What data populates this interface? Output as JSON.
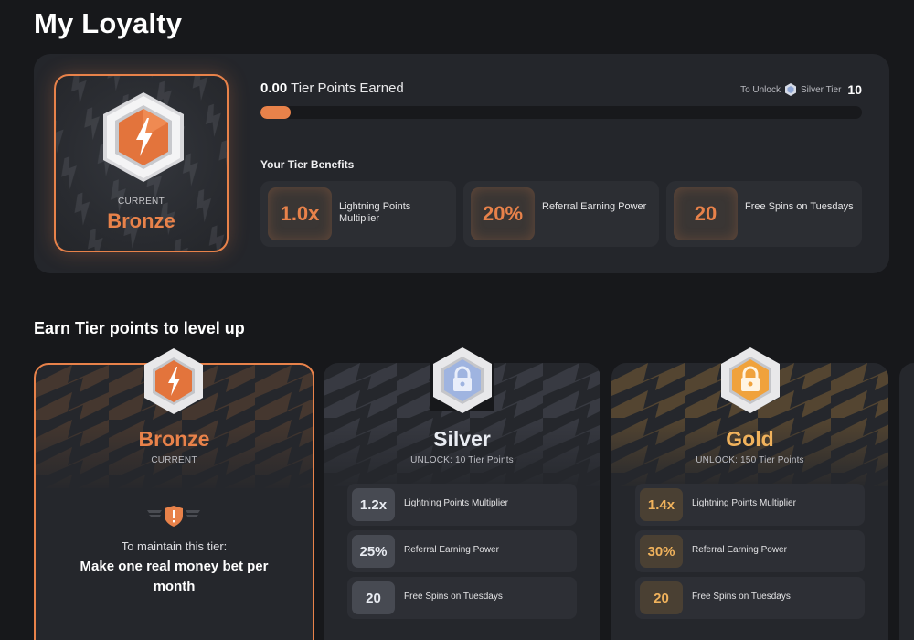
{
  "page": {
    "title": "My Loyalty"
  },
  "current_tier": {
    "label": "CURRENT",
    "name": "Bronze",
    "points_value": "0.00",
    "points_label": "Tier Points Earned",
    "unlock_prefix": "To Unlock",
    "next_tier": "Silver Tier",
    "next_tier_points": "10",
    "progress_fraction": 0.05,
    "benefits_title": "Your Tier Benefits",
    "benefits": [
      {
        "value": "1.0x",
        "label": "Lightning Points Multiplier"
      },
      {
        "value": "20%",
        "label": "Referral Earning Power"
      },
      {
        "value": "20",
        "label": "Free Spins on Tuesdays"
      }
    ]
  },
  "levels": {
    "title": "Earn Tier points to level up",
    "bronze": {
      "name": "Bronze",
      "sub": "CURRENT",
      "maintain_line1": "To maintain this tier:",
      "maintain_line2": "Make one real money bet per month"
    },
    "silver": {
      "name": "Silver",
      "sub": "UNLOCK: 10 Tier Points",
      "benefits": [
        {
          "value": "1.2x",
          "label": "Lightning Points Multiplier"
        },
        {
          "value": "25%",
          "label": "Referral Earning Power"
        },
        {
          "value": "20",
          "label": "Free Spins on Tuesdays"
        }
      ]
    },
    "gold": {
      "name": "Gold",
      "sub": "UNLOCK: 150 Tier Points",
      "benefits": [
        {
          "value": "1.4x",
          "label": "Lightning Points Multiplier"
        },
        {
          "value": "30%",
          "label": "Referral Earning Power"
        },
        {
          "value": "20",
          "label": "Free Spins on Tuesdays"
        }
      ]
    }
  },
  "colors": {
    "bronze": "#e8824a",
    "silver": "#9fb4e0",
    "gold": "#f0b25c",
    "background": "#17181b",
    "panel": "#24262b"
  },
  "icons": {
    "bronze_badge": "bronze-hex-bolt-icon",
    "silver_badge": "silver-hex-lock-icon",
    "gold_badge": "gold-hex-lock-icon",
    "maintain": "shield-alert-icon"
  }
}
